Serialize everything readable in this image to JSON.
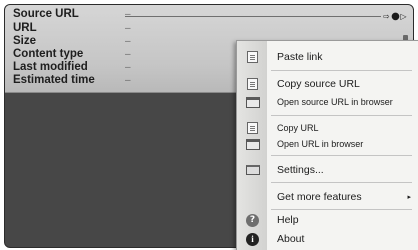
{
  "info_panel": {
    "rows": [
      {
        "label": "Source URL",
        "value": "–"
      },
      {
        "label": "URL",
        "value": "–"
      },
      {
        "label": "Size",
        "value": "–"
      },
      {
        "label": "Content type",
        "value": "–"
      },
      {
        "label": "Last modified",
        "value": "–"
      },
      {
        "label": "Estimated time",
        "value": "–"
      }
    ]
  },
  "window_controls": {
    "nav": "⇨",
    "dot": "●",
    "close": "▷"
  },
  "context_menu": {
    "items": [
      {
        "label": "Paste link",
        "icon": "paste-icon"
      },
      {
        "label": "Copy source URL",
        "icon": "copy-icon"
      },
      {
        "label": "Open source URL in browser",
        "icon": "browser-window-icon"
      },
      {
        "label": "Copy URL",
        "icon": "copy-icon"
      },
      {
        "label": "Open URL in browser",
        "icon": "browser-window-icon"
      },
      {
        "label": "Settings...",
        "icon": "settings-icon"
      },
      {
        "label": "Get more features",
        "submenu_arrow": "▸"
      },
      {
        "label": "Help",
        "icon": "help-icon"
      },
      {
        "label": "About",
        "icon": "about-icon"
      }
    ]
  }
}
